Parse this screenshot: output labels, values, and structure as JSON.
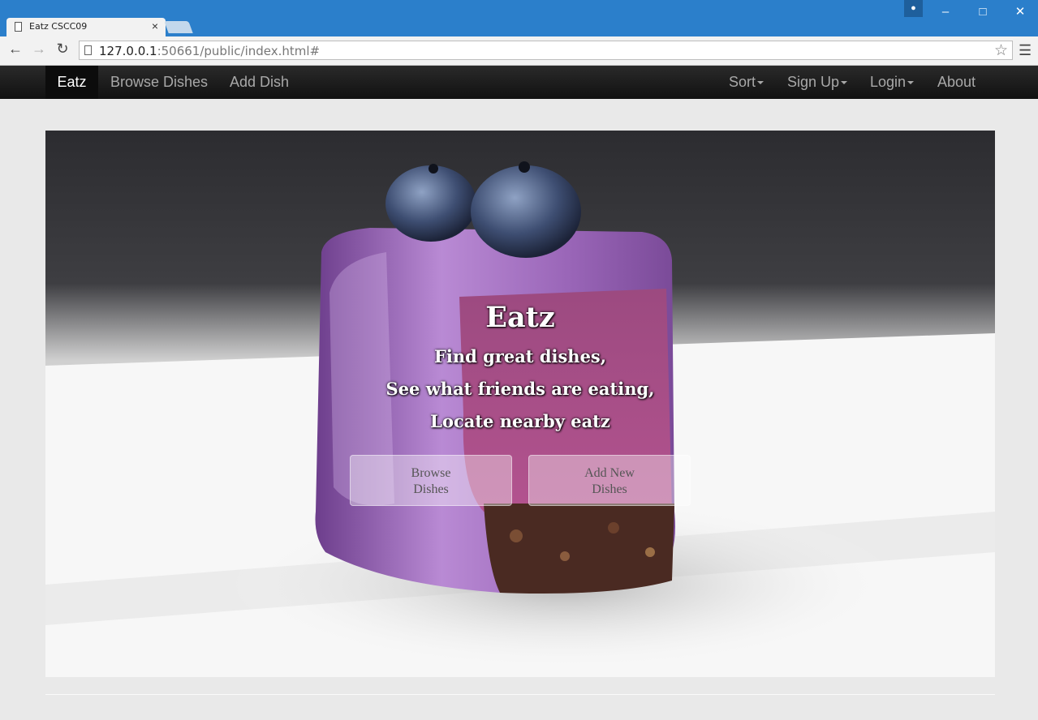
{
  "browser": {
    "tab_title": "Eatz CSCC09",
    "url_host": "127.0.0.1",
    "url_rest": ":50661/public/index.html#"
  },
  "navbar": {
    "brand": "Eatz",
    "left_items": [
      "Browse Dishes",
      "Add Dish"
    ],
    "right_items": [
      "Sort",
      "Sign Up",
      "Login",
      "About"
    ]
  },
  "hero": {
    "title": "Eatz",
    "lines": [
      "Find great dishes,",
      "See what friends are eating,",
      "Locate nearby eatz"
    ],
    "buttons": [
      "Browse Dishes",
      "Add New Dishes"
    ]
  },
  "colors": {
    "titlebar": "#2b7fcb",
    "navbar": "#1a1a1a",
    "icing": "#8e57ad"
  }
}
